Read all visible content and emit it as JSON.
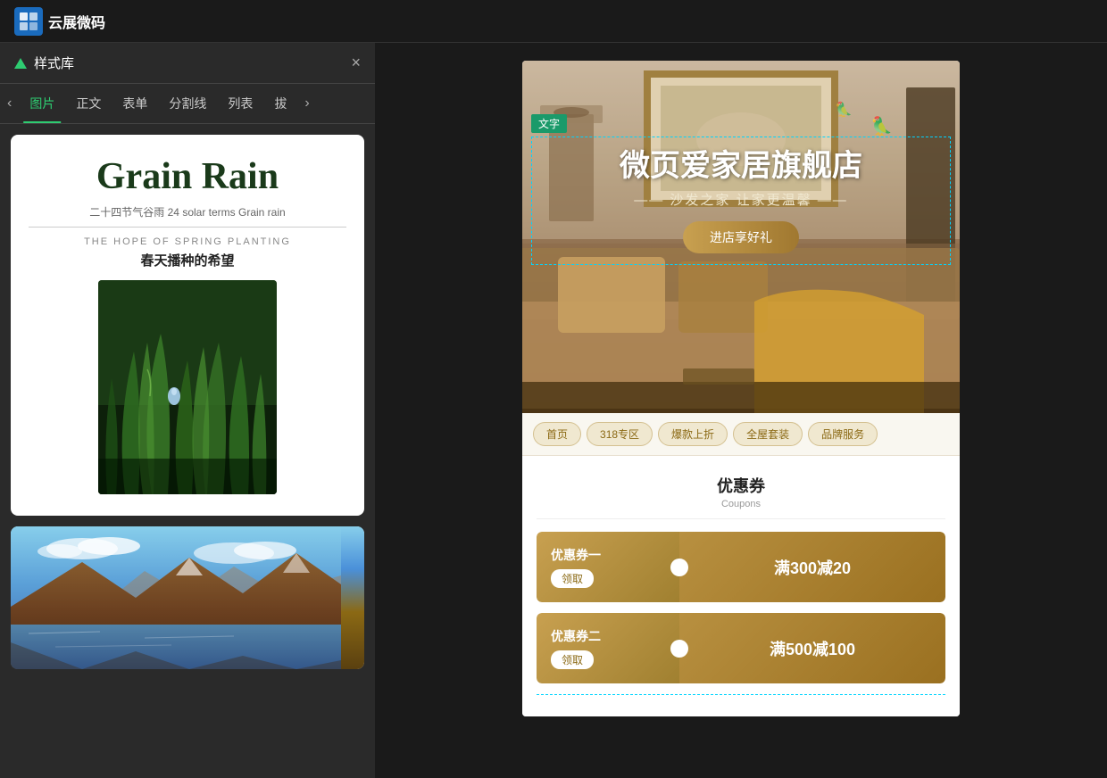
{
  "app": {
    "logo_text": "云展微码",
    "logo_icon": "图"
  },
  "left_panel": {
    "title": "样式库",
    "close_label": "×",
    "tabs": [
      {
        "id": "image",
        "label": "图片",
        "active": true
      },
      {
        "id": "text",
        "label": "正文",
        "active": false
      },
      {
        "id": "table",
        "label": "表单",
        "active": false
      },
      {
        "id": "divider",
        "label": "分割线",
        "active": false
      },
      {
        "id": "list",
        "label": "列表",
        "active": false
      },
      {
        "id": "more",
        "label": "拔",
        "active": false
      }
    ],
    "nav_prev": "‹",
    "nav_next": "›",
    "cards": [
      {
        "id": "grain-rain",
        "title": "Grain Rain",
        "subtitle": "二十四节气谷雨 24  solar terms Grain rain",
        "en_label": "THE HOPE OF SPRING PLANTING",
        "cn_label": "春天播种的希望",
        "img_alt": "grass with water droplets"
      },
      {
        "id": "mountain",
        "img_alt": "mountain lake landscape"
      }
    ]
  },
  "right_panel": {
    "hero": {
      "selection_label": "文字",
      "title": "微页爱家居旗舰店",
      "subtitle": "—— 沙发之家 让家更温馨 ——",
      "button_label": "进店享好礼"
    },
    "nav_tabs": [
      {
        "label": "首页"
      },
      {
        "label": "318专区"
      },
      {
        "label": "爆款上折"
      },
      {
        "label": "全屋套装"
      },
      {
        "label": "品牌服务"
      }
    ],
    "coupons_section": {
      "title": "优惠券",
      "title_en": "Coupons",
      "items": [
        {
          "name": "优惠券一",
          "btn_label": "领取",
          "amount": "满300减20"
        },
        {
          "name": "优惠券二",
          "btn_label": "领取",
          "amount": "满500减100"
        }
      ]
    }
  }
}
